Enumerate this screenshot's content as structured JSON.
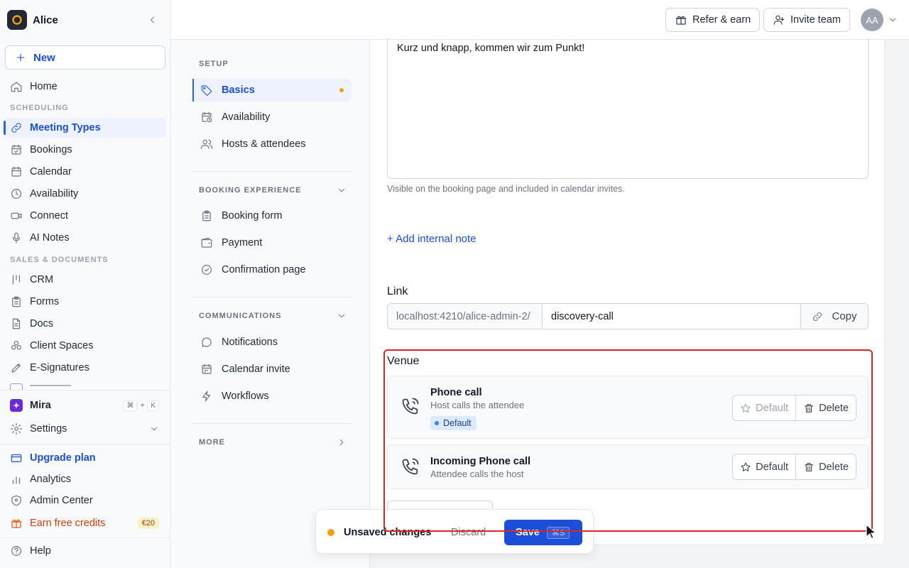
{
  "workspace": {
    "name": "Alice"
  },
  "sidebar": {
    "new_label": "New",
    "home": "Home",
    "sections": {
      "scheduling": "SCHEDULING",
      "sales": "SALES & DOCUMENTS"
    },
    "scheduling_items": [
      {
        "label": "Meeting Types",
        "icon": "link-icon",
        "active": true
      },
      {
        "label": "Bookings",
        "icon": "calendar-check-icon"
      },
      {
        "label": "Calendar",
        "icon": "calendar-icon"
      },
      {
        "label": "Availability",
        "icon": "clock-icon"
      },
      {
        "label": "Connect",
        "icon": "video-icon"
      },
      {
        "label": "AI Notes",
        "icon": "mic-icon"
      }
    ],
    "sales_items": [
      {
        "label": "CRM",
        "icon": "crm-icon"
      },
      {
        "label": "Forms",
        "icon": "clipboard-icon"
      },
      {
        "label": "Docs",
        "icon": "file-icon"
      },
      {
        "label": "Client Spaces",
        "icon": "circles-icon"
      },
      {
        "label": "E-Signatures",
        "icon": "pen-icon"
      }
    ],
    "mira": {
      "label": "Mira",
      "shortcut": [
        "⌘",
        "+",
        "K"
      ]
    },
    "settings": "Settings",
    "upgrade": "Upgrade plan",
    "analytics": "Analytics",
    "admin_center": "Admin Center",
    "earn_credits": "Earn free credits",
    "earn_badge": "€20",
    "help": "Help"
  },
  "topbar": {
    "refer_label": "Refer & earn",
    "invite_label": "Invite team",
    "avatar_initials": "AA"
  },
  "setup_nav": {
    "setup_title": "SETUP",
    "setup_items": [
      {
        "label": "Basics",
        "icon": "tag-icon",
        "active": true,
        "unsaved": true
      },
      {
        "label": "Availability",
        "icon": "calendar-clock-icon"
      },
      {
        "label": "Hosts & attendees",
        "icon": "users-icon"
      }
    ],
    "booking_title": "BOOKING EXPERIENCE",
    "booking_items": [
      {
        "label": "Booking form",
        "icon": "clipboard-icon"
      },
      {
        "label": "Payment",
        "icon": "wallet-icon"
      },
      {
        "label": "Confirmation page",
        "icon": "check-circle-icon"
      }
    ],
    "communications_title": "COMMUNICATIONS",
    "communications_items": [
      {
        "label": "Notifications",
        "icon": "chat-icon"
      },
      {
        "label": "Calendar invite",
        "icon": "calendar-icon"
      },
      {
        "label": "Workflows",
        "icon": "bolt-icon"
      }
    ],
    "more_title": "MORE"
  },
  "main": {
    "description_text": "Kurz und knapp, kommen wir zum Punkt!",
    "description_hint": "Visible on the booking page and included in calendar invites.",
    "add_internal_note": "+ Add internal note",
    "link_label": "Link",
    "link_prefix": "localhost:4210/alice-admin-2/",
    "link_slug": "discovery-call",
    "copy_label": "Copy",
    "venue_label": "Venue",
    "venues": [
      {
        "title": "Phone call",
        "subtitle": "Host calls the attendee",
        "badge": "Default",
        "default_label": "Default",
        "delete_label": "Delete",
        "is_default": true
      },
      {
        "title": "Incoming Phone call",
        "subtitle": "Attendee calls the host",
        "default_label": "Default",
        "delete_label": "Delete",
        "is_default": false
      }
    ]
  },
  "unsaved_bar": {
    "text": "Unsaved changes",
    "discard": "Discard",
    "save": "Save",
    "shortcut": "⌘S"
  },
  "colors": {
    "accent": "#1d4ed8",
    "unsaved_dot": "#f59e0b",
    "highlight": "#dc2626"
  }
}
